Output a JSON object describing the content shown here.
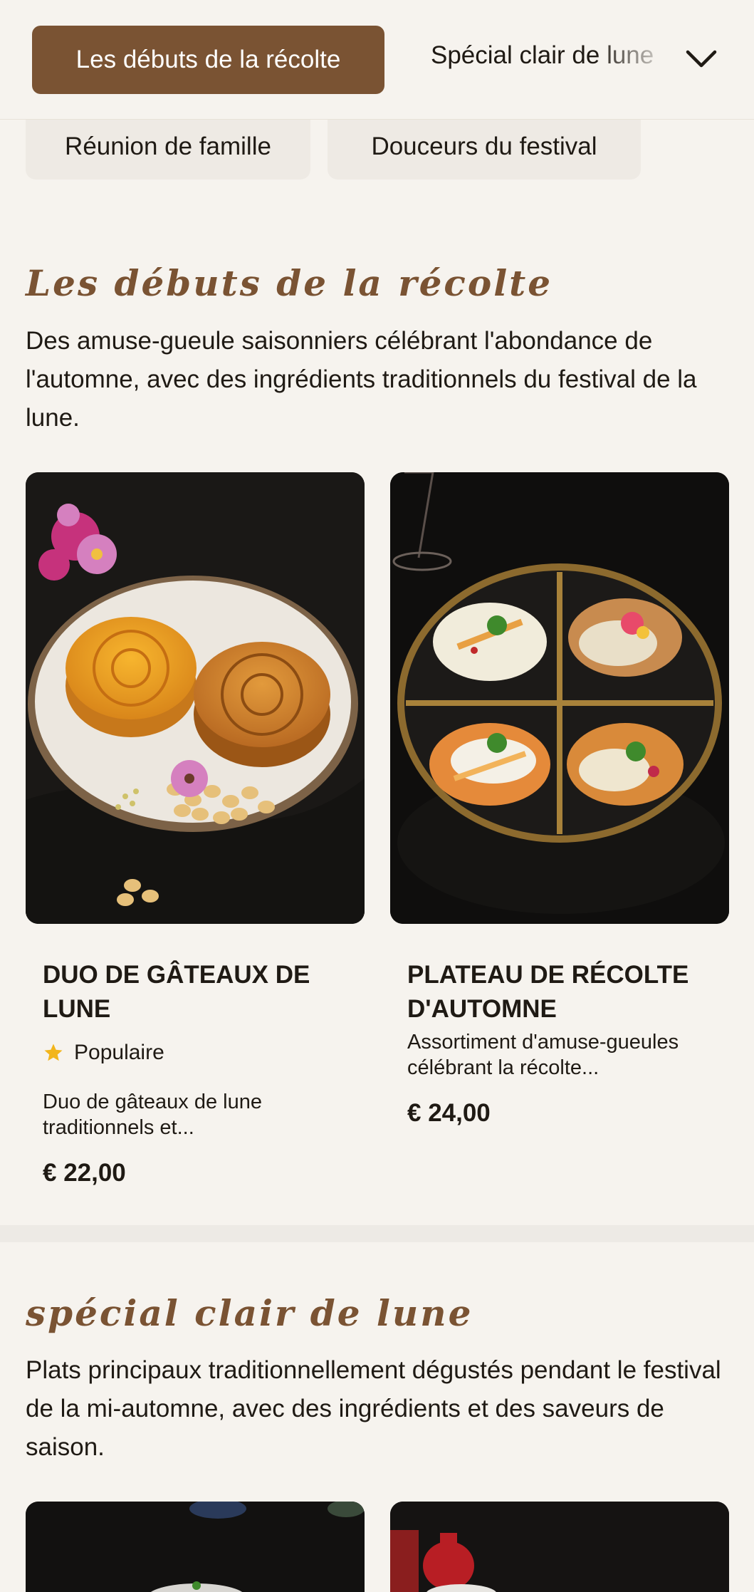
{
  "categories": {
    "active": "Les débuts de la récolte",
    "next": "Spécial clair de lune",
    "chips": [
      "Réunion de famille",
      "Douceurs du festival"
    ]
  },
  "sections": [
    {
      "title": "Les débuts de la récolte",
      "description": "Des amuse-gueule saisonniers célébrant l'abondance de l'automne, avec des ingrédients traditionnels du festival de la lune.",
      "items": [
        {
          "name": "DUO DE GÂTEAUX DE LUNE",
          "badge": "Populaire",
          "description": "Duo de gâteaux de lune traditionnels et...",
          "price": "€ 22,00"
        },
        {
          "name": "PLATEAU DE RÉCOLTE D'AUTOMNE",
          "description": "Assortiment d'amuse-gueules célébrant la récolte...",
          "price": "€ 24,00"
        }
      ]
    },
    {
      "title": "spécial clair de lune",
      "description": "Plats principaux traditionnellement dégustés pendant le festival de la mi-automne, avec des ingrédients et des saveurs de saison."
    }
  ],
  "colors": {
    "accent": "#7a5333",
    "background": "#f6f3ee",
    "star": "#f2b51b"
  }
}
